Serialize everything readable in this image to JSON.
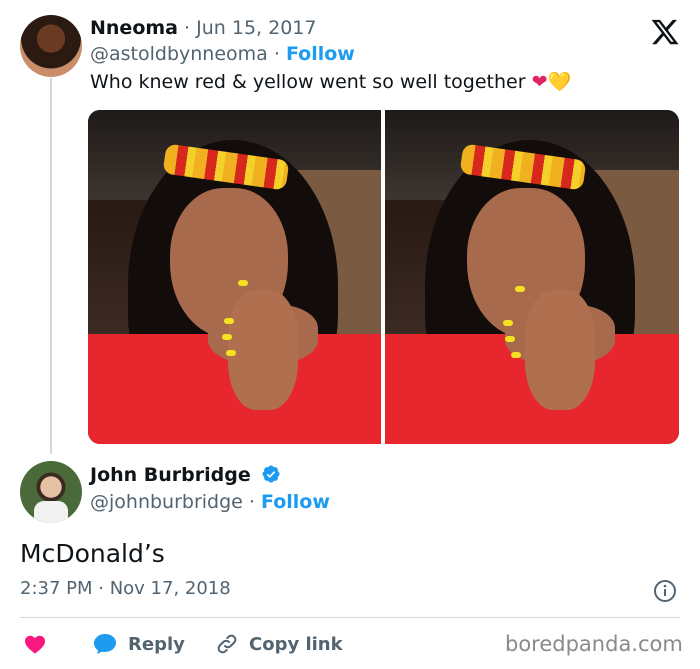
{
  "original_tweet": {
    "name": "Nneoma",
    "date": "· Jun 15, 2017",
    "handle": "@astoldbynneoma",
    "separator": "·",
    "follow_label": "Follow",
    "text": "Who knew red & yellow went so well together",
    "emoji_1": "❤",
    "emoji_2": "💛",
    "images": [
      "photo-left",
      "photo-right"
    ]
  },
  "reply_tweet": {
    "name": "John Burbridge",
    "verified": true,
    "handle": "@johnburbridge",
    "separator": "·",
    "follow_label": "Follow",
    "text": "McDonald’s",
    "timestamp": "2:37 PM · Nov 17, 2018"
  },
  "actions": {
    "like_icon": "heart-icon",
    "reply_label": "Reply",
    "copy_link_label": "Copy link"
  },
  "watermark": "boredpanda.com",
  "colors": {
    "accent": "#1d9bf0",
    "like": "#f91880",
    "text_primary": "#0f1419",
    "text_secondary": "#536471"
  }
}
